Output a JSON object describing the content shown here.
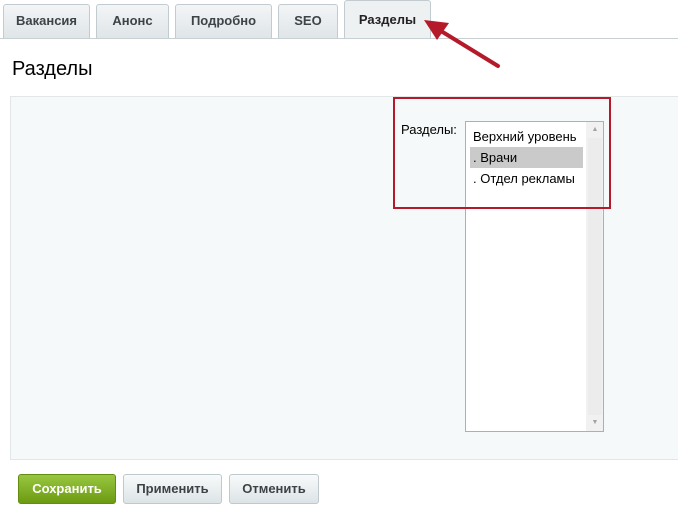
{
  "tabs": [
    {
      "label": "Вакансия"
    },
    {
      "label": "Анонс"
    },
    {
      "label": "Подробно"
    },
    {
      "label": "SEO"
    },
    {
      "label": "Разделы",
      "active": true
    }
  ],
  "page": {
    "title": "Разделы"
  },
  "form": {
    "sections_label": "Разделы:",
    "sections_options": [
      {
        "label": "Верхний уровень",
        "selected": false
      },
      {
        "label": ". Врачи",
        "selected": true
      },
      {
        "label": ". Отдел рекламы",
        "selected": false
      }
    ]
  },
  "buttons": {
    "save": "Сохранить",
    "apply": "Применить",
    "cancel": "Отменить"
  },
  "colors": {
    "annotation": "#b51a2a",
    "save_button": "#7eac23"
  }
}
